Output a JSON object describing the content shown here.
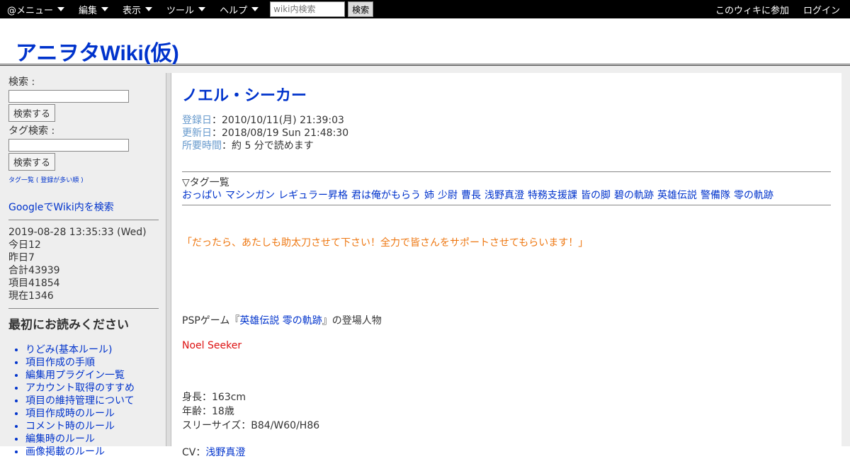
{
  "topbar": {
    "menus": [
      "@メニュー",
      "編集",
      "表示",
      "ツール",
      "ヘルプ"
    ],
    "search_placeholder": "wiki内検索",
    "search_button": "検索",
    "join": "このウィキに参加",
    "login": "ログイン"
  },
  "site_title": "アニヲタWiki(仮)",
  "sidebar": {
    "search_label": "検索 :",
    "search_button": "検索する",
    "tag_search_label": "タグ検索 :",
    "tag_search_button": "検索する",
    "tag_list_link": "タグ一覧",
    "tag_popular_link": "登録が多い順",
    "google_search": "GoogleでWiki内を検索",
    "datetime": "2019-08-28 13:35:33 (Wed)",
    "today": "今日12",
    "yesterday": "昨日7",
    "total": "合計43939",
    "items": "項目41854",
    "current": "現在1346",
    "heading": "最初にお読みください",
    "links": [
      "りどみ(基本ルール)",
      "項目作成の手順",
      "編集用プラグイン一覧",
      "アカウント取得のすすめ",
      "項目の維持管理について",
      "項目作成時のルール",
      "コメント時のルール",
      "編集時のルール",
      "画像掲載のルール"
    ]
  },
  "article": {
    "title": "ノエル・シーカー",
    "registered_label": "登録日",
    "registered": "：2010/10/11(月) 21:39:03",
    "updated_label": "更新日",
    "updated": "：2018/08/19 Sun 21:48:30",
    "reading_label": "所要時間",
    "reading": "：約 5 分で読めます",
    "tags_heading": "▽タグ一覧",
    "tags": [
      "おっぱい",
      "マシンガン",
      "レギュラー昇格",
      "君は俺がもらう",
      "姉",
      "少尉",
      "曹長",
      "浅野真澄",
      "特務支援課",
      "皆の脚",
      "碧の軌跡",
      "英雄伝説",
      "警備隊",
      "零の軌跡"
    ],
    "quote": "「だったら、あたしも助太刀させて下さい！全力で皆さんをサポートさせてもらいます！」",
    "intro_prefix": "PSPゲーム『",
    "intro_link": "英雄伝説 零の軌跡",
    "intro_suffix": "』の登場人物",
    "english_name": "Noel Seeker",
    "height": "身長：163cm",
    "age": "年齢：18歳",
    "size": "スリーサイズ：B84/W60/H86",
    "cv_label": "CV：",
    "cv_link": "浅野真澄"
  }
}
